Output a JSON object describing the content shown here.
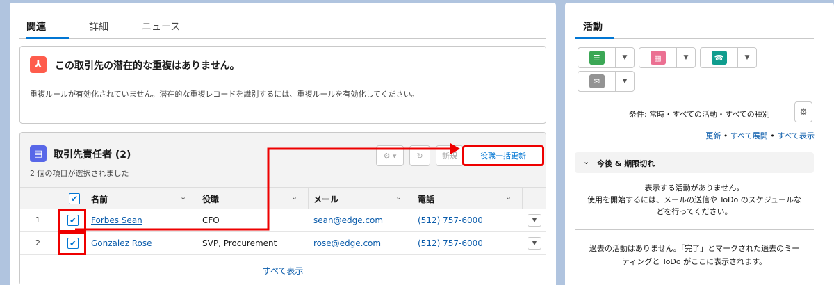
{
  "tabs": [
    "関連",
    "詳細",
    "ニュース"
  ],
  "duplicates": {
    "icon": "merge-icon",
    "title": "この取引先の潜在的な重複はありません。",
    "body": "重複ルールが有効化されていません。潜在的な重複レコードを識別するには、重複ルールを有効化してください。"
  },
  "contacts": {
    "icon": "contact-card-icon",
    "title": "取引先責任者 (2)",
    "selected_text": "2 個の項目が選択されました",
    "mass_update_label": "役職一括更新",
    "new_label": "新規",
    "columns": [
      "名前",
      "役職",
      "メール",
      "電話"
    ],
    "rows": [
      {
        "num": "1",
        "name": "Forbes Sean",
        "title": "CFO",
        "email": "sean@edge.com",
        "phone": "(512) 757-6000",
        "checked": true
      },
      {
        "num": "2",
        "name": "Gonzalez Rose",
        "title": "SVP, Procurement",
        "email": "rose@edge.com",
        "phone": "(512) 757-6000",
        "checked": true
      }
    ],
    "show_all": "すべて表示"
  },
  "activity": {
    "tab": "活動",
    "action_buttons": [
      {
        "icon": "task-icon",
        "color": "#3ba755"
      },
      {
        "icon": "calendar-icon",
        "color": "#eb7092"
      },
      {
        "icon": "call-log-icon",
        "color": "#0f9d8e"
      },
      {
        "icon": "email-icon",
        "color": "#939393"
      }
    ],
    "filter": "条件: 常時・すべての活動・すべての種別",
    "links": [
      "更新",
      "すべて展開",
      "すべて表示"
    ],
    "upcoming_title": "今後 & 期限切れ",
    "upcoming_empty_1": "表示する活動がありません。",
    "upcoming_empty_2": "使用を開始するには、メールの送信や ToDo のスケジュールな",
    "upcoming_empty_3": "どを行ってください。",
    "past_empty_1": "過去の活動はありません。「完了」とマークされた過去のミー",
    "past_empty_2": "ティングと ToDo がここに表示されます。"
  }
}
